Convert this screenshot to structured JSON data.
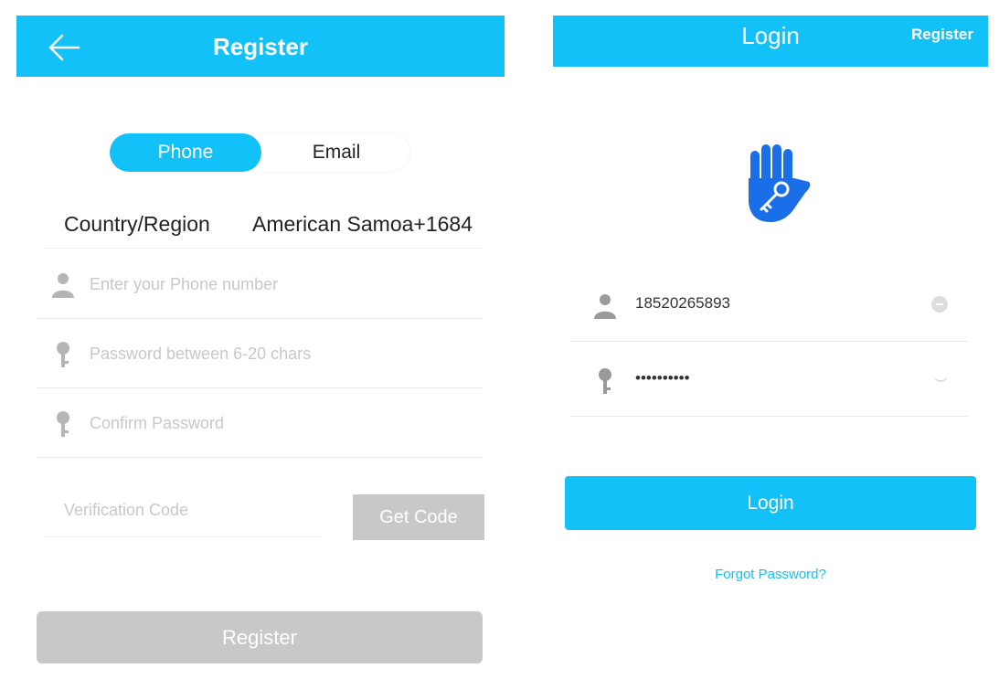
{
  "colors": {
    "accent": "#12c1f7",
    "disabled": "#c8c8c8",
    "logo": "#1a6fe8"
  },
  "register_screen": {
    "title": "Register",
    "tabs": [
      {
        "label": "Phone",
        "selected": true
      },
      {
        "label": "Email",
        "selected": false
      }
    ],
    "country": {
      "label": "Country/Region",
      "value": "American Samoa+1684"
    },
    "phone_placeholder": "Enter your Phone number",
    "password_placeholder": "Password between 6-20 chars",
    "confirm_placeholder": "Confirm Password",
    "verification_placeholder": "Verification Code",
    "get_code_label": "Get Code",
    "register_label": "Register"
  },
  "login_screen": {
    "title": "Login",
    "register_link": "Register",
    "logo_icon": "hand-key-icon",
    "username_value": "18520265893",
    "password_value": "••••••••••",
    "login_label": "Login",
    "forgot_label": "Forgot Password?"
  }
}
